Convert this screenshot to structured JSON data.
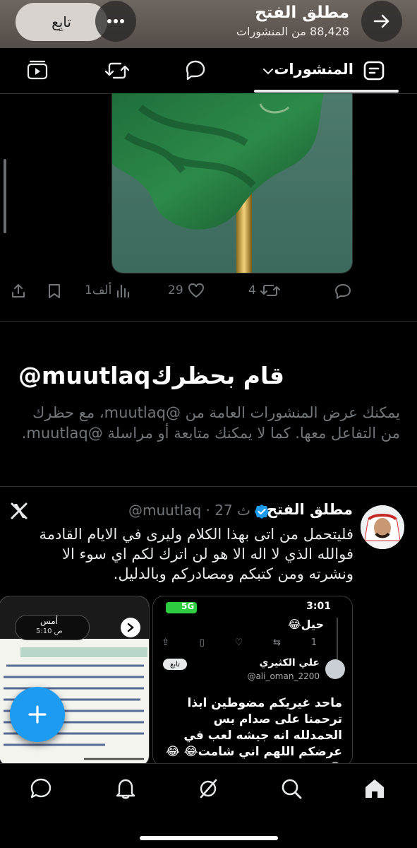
{
  "header": {
    "title": "مطلق الفتح",
    "subtitle": "88,428 من المنشورات",
    "follow_label": "تابِع"
  },
  "tabs": {
    "active_label": "المنشورات"
  },
  "post_actions": {
    "views": "1ألف",
    "likes": "29",
    "reposts": "4"
  },
  "blocked": {
    "title": "قام بحظرك",
    "handle": "@muutlaq",
    "body": "يمكنك عرض المنشورات العامة من @muutlaq، مع حظرك من التفاعل معها. كما لا يمكنك متابعة أو مراسلة @muutlaq."
  },
  "post": {
    "name": "مطلق الفتح",
    "meta": "@muutlaq · 27 ث",
    "text": "فليتحمل من اتى بهذا الكلام وليرى في الايام القادمة فوالله الذي لا اله الا هو لن اترك لكم اي سوء الا ونشرته ومن كتبكم ومصادركم وبالدليل."
  },
  "embedded_card": {
    "time": "3:01",
    "signal": "5G",
    "reply_text": "حيل😂",
    "count": "1",
    "follow_label": "تابع",
    "user_name": "علي الكثيري",
    "user_handle": "@ali_oman_2200",
    "tweet_text": "ماحد غيريكم مضوطين ابذا ترحمنا على صدام بس الحمدلله انه جيشه لعب في عرضكم اللهم اني شامت😂 😂😂"
  },
  "second_card": {
    "date_label": "أمس",
    "time_label": "5:10 ص"
  },
  "colors": {
    "accent": "#1d9bf0",
    "background": "#000000",
    "muted": "#71767b"
  }
}
